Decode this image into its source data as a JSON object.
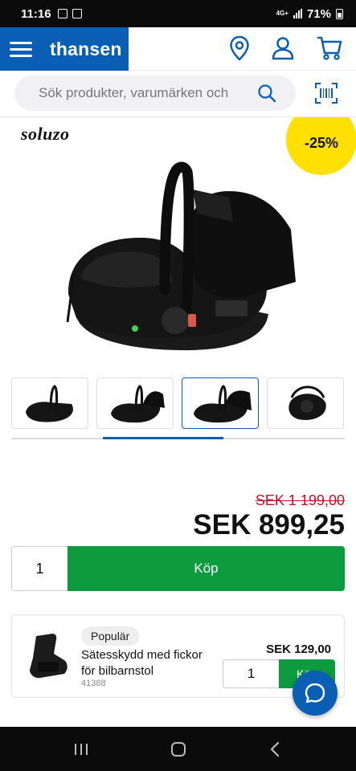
{
  "status_bar": {
    "time": "11:16",
    "network": "4G+",
    "battery": "71%"
  },
  "header": {
    "brand": "thansen"
  },
  "search": {
    "placeholder": "Sök produkter, varumärken och"
  },
  "product": {
    "brand_logo": "soluzo",
    "discount_badge": "-25%",
    "thumbnail_count": 4,
    "active_thumbnail": 3,
    "old_price": "SEK 1 199,00",
    "price": "SEK 899,25",
    "quantity": "1",
    "buy_label": "Köp"
  },
  "accessory": {
    "badge": "Populär",
    "title": "Sätesskydd med fickor för bilbarnstol",
    "sku": "41388",
    "price": "SEK 129,00",
    "quantity": "1",
    "buy_label": "Köp"
  },
  "colors": {
    "brand_blue": "#0a5fb4",
    "buy_green": "#0e9a3f",
    "discount_yellow": "#ffe000",
    "old_price_red": "#c8102e"
  }
}
